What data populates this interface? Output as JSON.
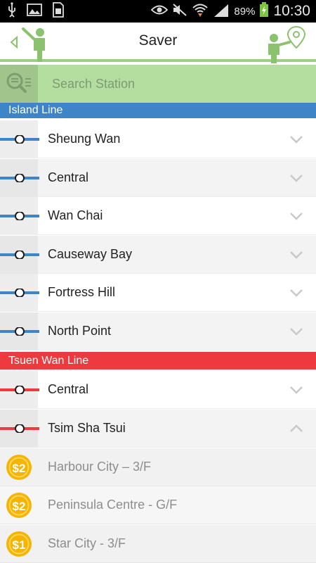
{
  "status_bar": {
    "battery": "89%",
    "time": "10:30"
  },
  "header": {
    "title": "Saver"
  },
  "search": {
    "placeholder": "Search Station"
  },
  "colors": {
    "island_line": "#3d85c6",
    "tsuen_wan_line": "#ee3a3f",
    "header_underline": "#9ccf7e",
    "search_bg": "#b4dea0"
  },
  "lines": [
    {
      "name": "Island Line",
      "stations": [
        "Sheung Wan",
        "Central",
        "Wan Chai",
        "Causeway Bay",
        "Fortress Hill",
        "North Point"
      ]
    },
    {
      "name": "Tsuen Wan Line",
      "stations": [
        "Central",
        "Tsim Sha Tsui"
      ]
    }
  ],
  "shops": [
    {
      "name": "Harbour City – 3/F",
      "coin": "2"
    },
    {
      "name": "Peninsula Centre - G/F",
      "coin": "2"
    },
    {
      "name": "Star City - 3/F",
      "coin": "1"
    }
  ]
}
